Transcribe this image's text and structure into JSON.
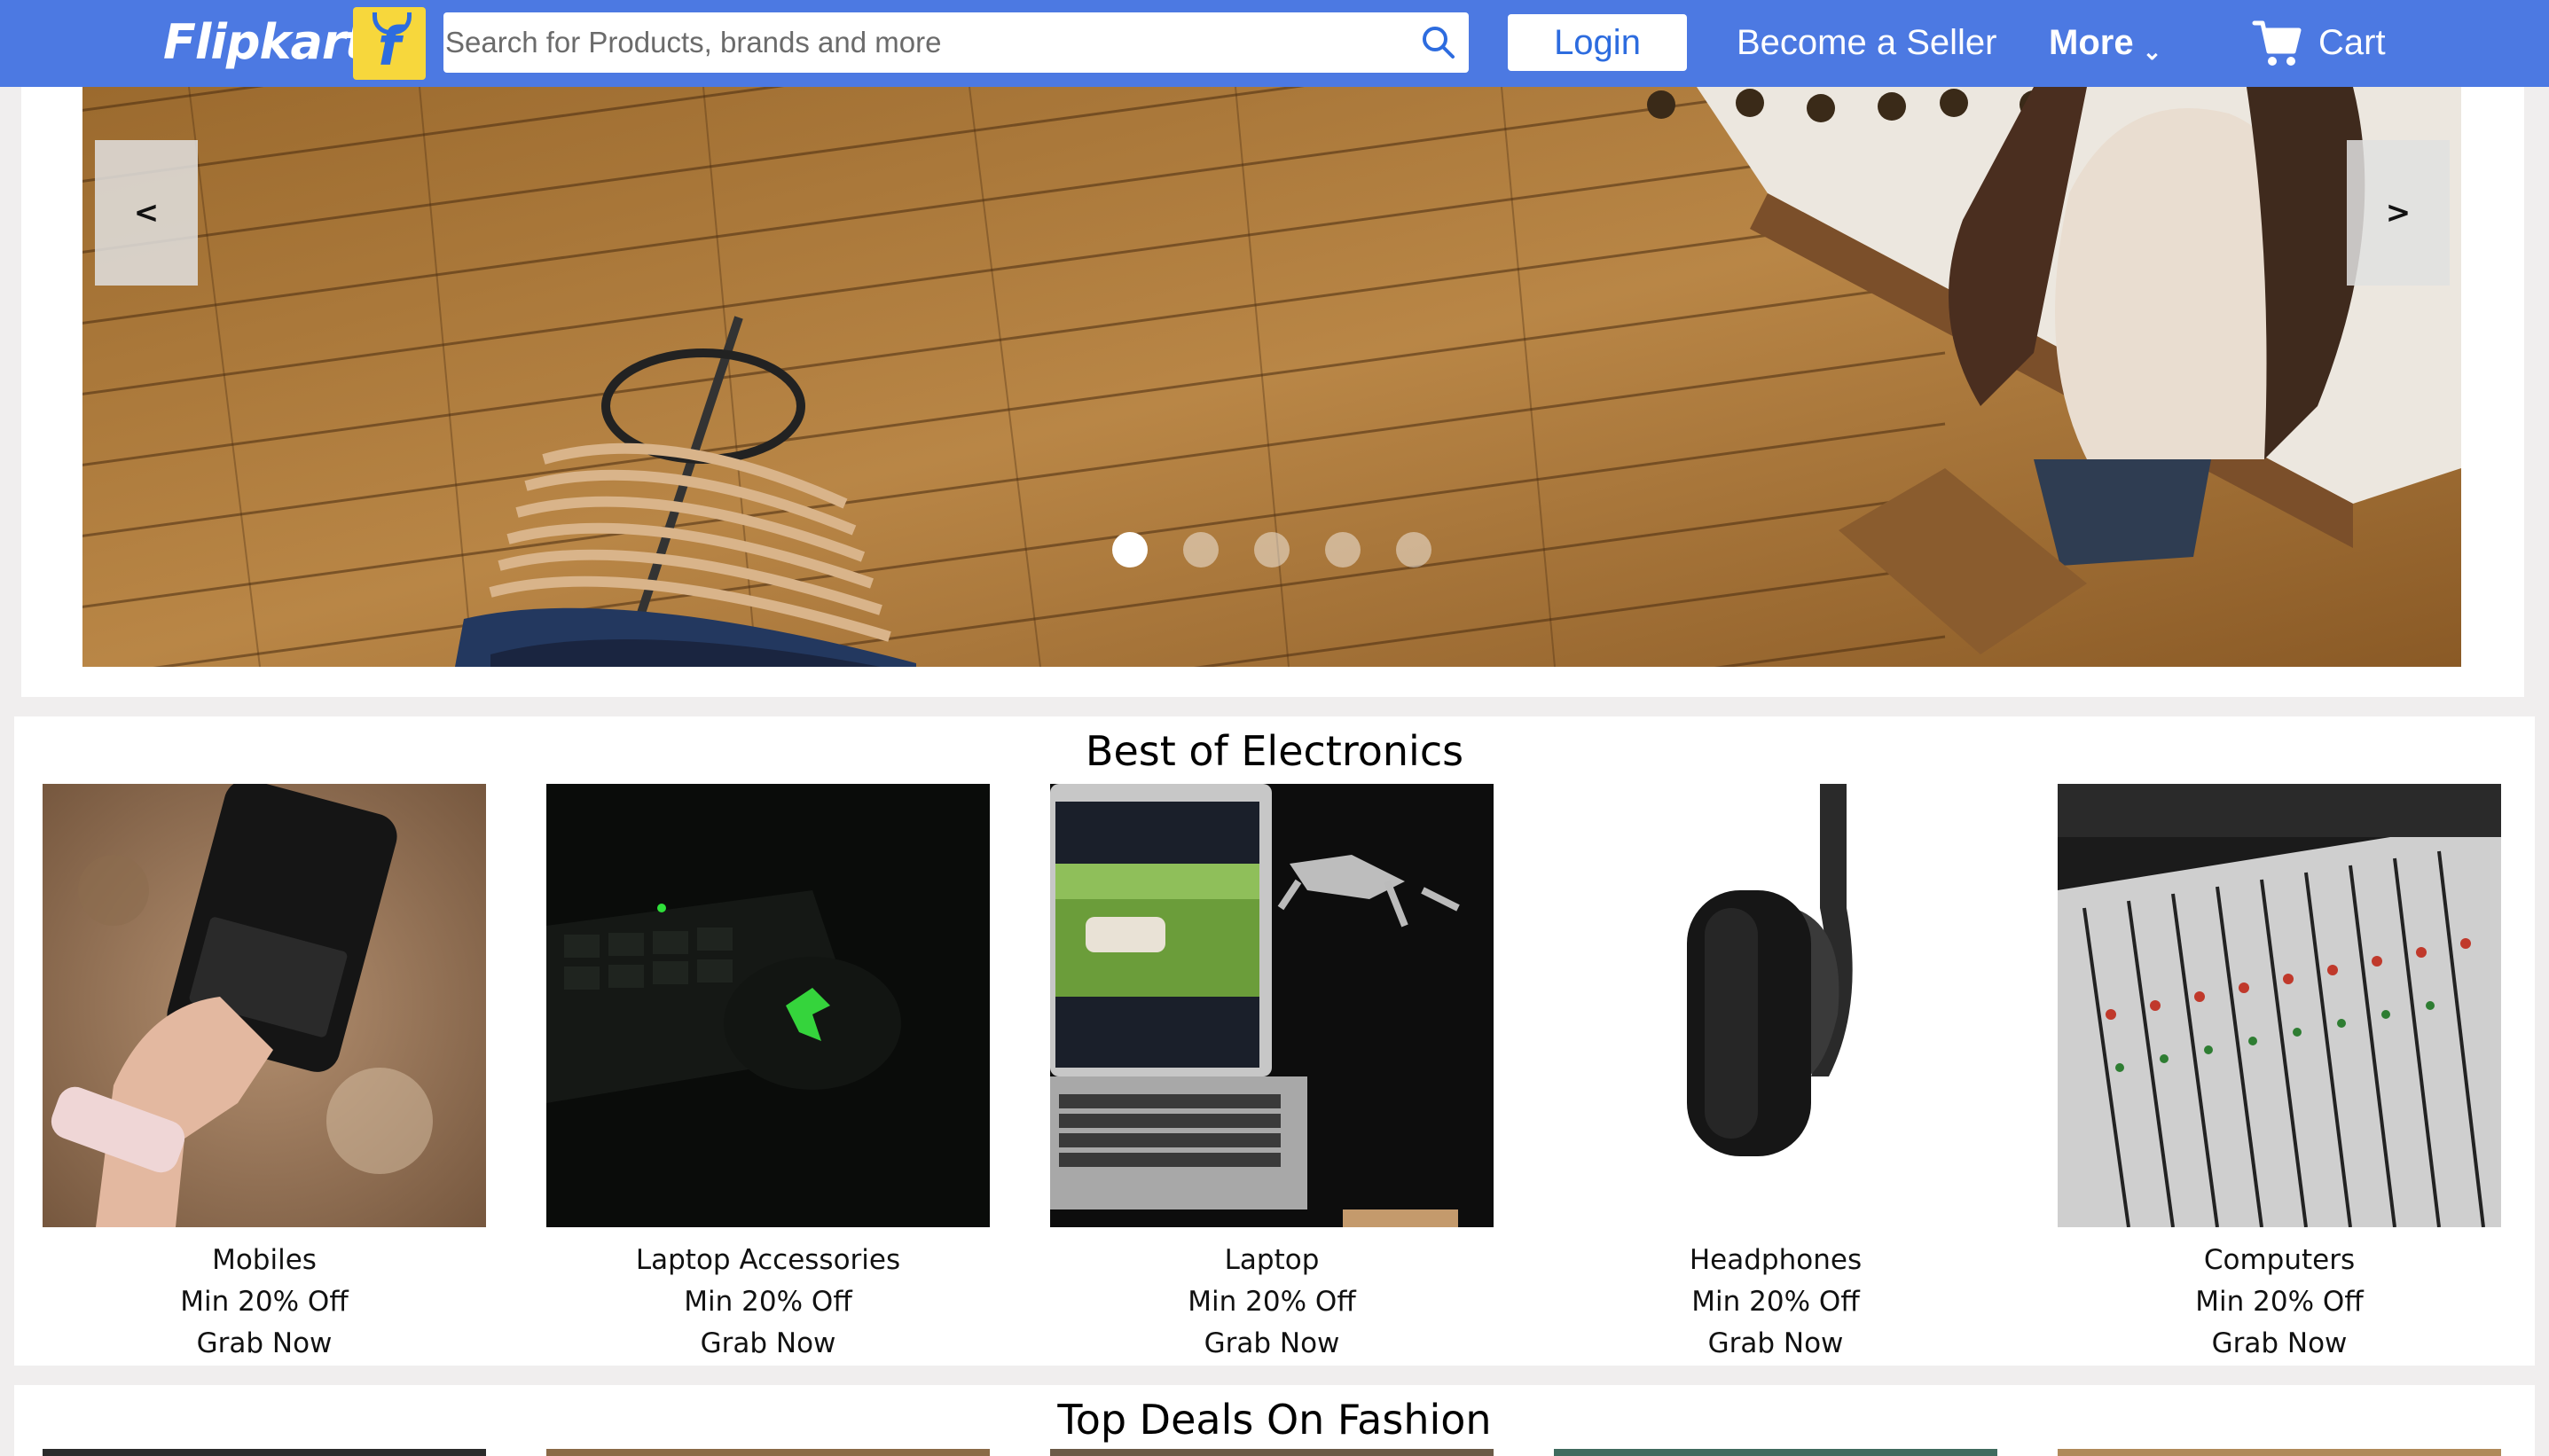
{
  "header": {
    "logo_text": "Flipkart",
    "logo_mark": "f",
    "search_placeholder": "Search for Products, brands and more",
    "login_label": "Login",
    "seller_label": "Become a Seller",
    "more_label": "More",
    "more_chevron": "⌄",
    "cart_label": "Cart",
    "colors": {
      "bar": "#4c79e2",
      "logo_bag": "#f7d73c"
    }
  },
  "carousel": {
    "prev_label": "<",
    "next_label": ">",
    "slide_count": 5,
    "active_slide": 1
  },
  "electronics": {
    "title": "Best of Electronics",
    "items": [
      {
        "name": "Mobiles",
        "offer": "Min 20% Off",
        "cta": "Grab Now",
        "icon": "phone-photo"
      },
      {
        "name": "Laptop Accessories",
        "offer": "Min 20% Off",
        "cta": "Grab Now",
        "icon": "mouse-photo"
      },
      {
        "name": "Laptop",
        "offer": "Min 20% Off",
        "cta": "Grab Now",
        "icon": "laptop-photo"
      },
      {
        "name": "Headphones",
        "offer": "Min 20% Off",
        "cta": "Grab Now",
        "icon": "headphones-photo"
      },
      {
        "name": "Computers",
        "offer": "Min 20% Off",
        "cta": "Grab Now",
        "icon": "mixer-photo"
      }
    ]
  },
  "fashion": {
    "title": "Top Deals On Fashion"
  }
}
